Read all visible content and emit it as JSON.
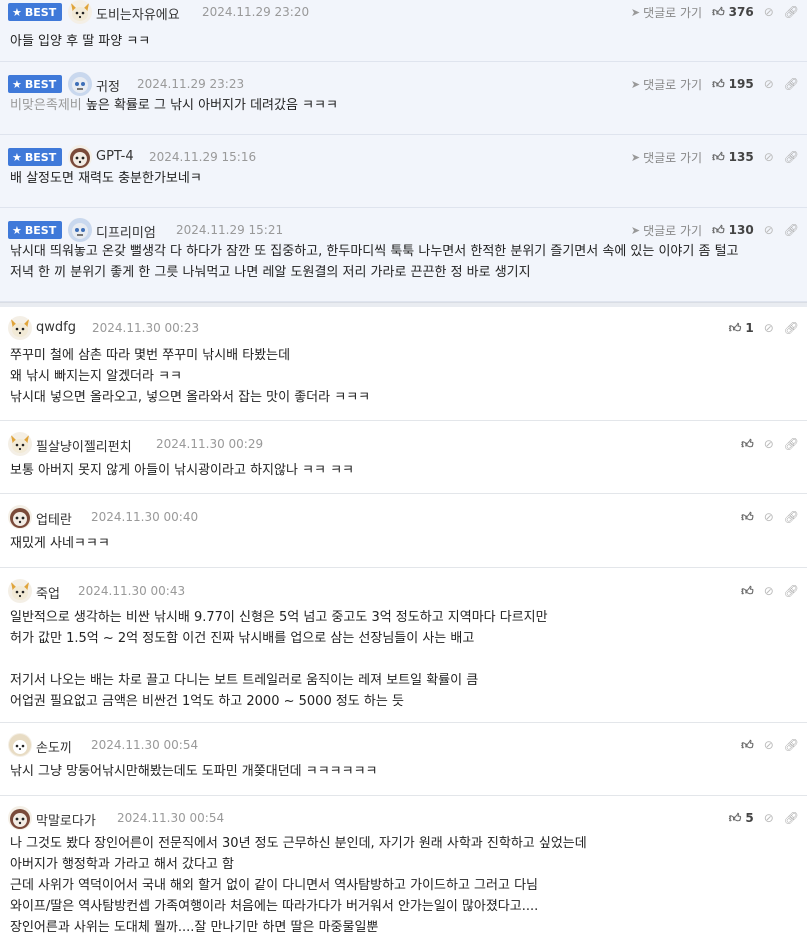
{
  "ui": {
    "reply_label": "댓글로 가기",
    "best_label": "BEST"
  },
  "best_comments": [
    {
      "nick": "도비는자유에요",
      "date": "2024.11.29 23:20",
      "likes": "376",
      "avatar": "fox",
      "lines": [
        "아들 입양 후 딸 파양 ㅋㅋ"
      ]
    },
    {
      "nick": "귀정",
      "date": "2024.11.29 23:23",
      "likes": "195",
      "avatar": "robot",
      "quote": "비맞은족제비",
      "lines": [
        "높은 확률로 그 낚시 아버지가 데려갔음 ㅋㅋㅋ"
      ]
    },
    {
      "nick": "GPT-4",
      "date": "2024.11.29 15:16",
      "likes": "135",
      "avatar": "dog",
      "lines": [
        "배 살정도면 재력도 충분한가보네ㅋ"
      ]
    },
    {
      "nick": "디프리미엄",
      "date": "2024.11.29 15:21",
      "likes": "130",
      "avatar": "robot",
      "lines": [
        "낚시대 띄워놓고 온갖 뻘생각 다 하다가 잠깐 또 집중하고, 한두마디씩 툭툭 나누면서 한적한 분위기 즐기면서 속에 있는 이야기 좀 털고",
        "저녁 한 끼 분위기 좋게 한 그릇 나눠먹고 나면 레알 도원결의 저리 가라로 끈끈한 정 바로 생기지"
      ]
    }
  ],
  "comments": [
    {
      "nick": "qwdfg",
      "date": "2024.11.30 00:23",
      "likes": "1",
      "avatar": "fox",
      "lines": [
        "쭈꾸미 철에 삼촌 따라 몇번 쭈꾸미 낚시배 타봤는데",
        "왜 낚시 빠지는지 알겠더라 ㅋㅋ",
        "낚시대 넣으면 올라오고, 넣으면 올라와서 잡는 맛이 좋더라 ㅋㅋㅋ"
      ]
    },
    {
      "nick": "필살냥이젤리펀치",
      "date": "2024.11.30 00:29",
      "likes": "",
      "avatar": "fox",
      "lines": [
        "보통 아버지 못지 않게 아들이 낚시광이라고 하지않나 ㅋㅋ ㅋㅋ"
      ]
    },
    {
      "nick": "업테란",
      "date": "2024.11.30 00:40",
      "likes": "",
      "avatar": "dog",
      "lines": [
        "재밌게 사네ㅋㅋㅋ"
      ]
    },
    {
      "nick": "죽업",
      "date": "2024.11.30 00:43",
      "likes": "",
      "avatar": "fox",
      "lines": [
        "일반적으로 생각하는 비싼 낚시배 9.77이 신형은 5억 넘고 중고도 3억 정도하고 지역마다 다르지만",
        "허가 값만 1.5억 ~ 2억 정도함 이건 진짜 낚시배를 업으로 삼는 선장님들이 사는 배고",
        "",
        "저기서 나오는 배는 차로 끌고 다니는 보트 트레일러로 움직이는 레져 보트일 확률이 큼",
        "어업권 필요없고 금액은 비싼건 1억도 하고 2000 ~ 5000 정도 하는 듯"
      ]
    },
    {
      "nick": "손도끼",
      "date": "2024.11.30 00:54",
      "likes": "",
      "avatar": "face",
      "lines": [
        "낚시 그냥 망둥어낚시만해봤는데도 도파민 개쫒대던데 ㅋㅋㅋㅋㅋㅋ"
      ]
    },
    {
      "nick": "막말로다가",
      "date": "2024.11.30 00:54",
      "likes": "5",
      "avatar": "dog",
      "lines": [
        "나 그것도 봤다 장인어른이 전문직에서 30년 정도 근무하신 분인데, 자기가 원래 사학과 진학하고 싶었는데",
        "아버지가 행정학과 가라고 해서 갔다고 함",
        "근데 사위가 역덕이어서 국내 해외 할거 없이 같이 다니면서 역사탐방하고 가이드하고 그러고 다님",
        "와이프/딸은 역사탐방컨셉 가족여행이라 처음에는 따라가다가 버거워서 안가는일이 많아졌다고....",
        "장인어른과 사위는 도대체 뭘까....잘 만나기만 하면 딸은 마중물일뿐"
      ]
    }
  ]
}
